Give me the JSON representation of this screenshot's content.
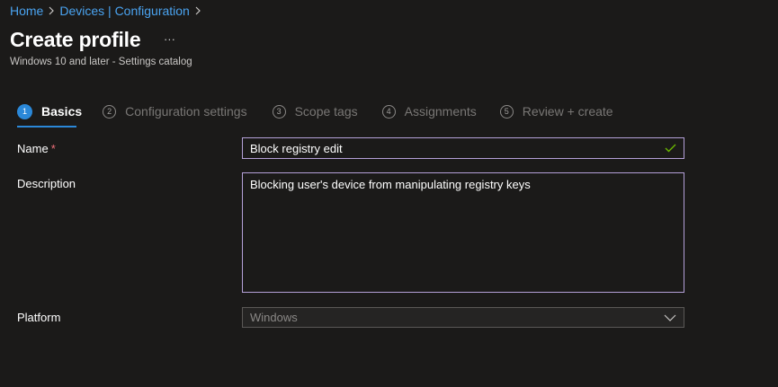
{
  "breadcrumb": {
    "items": [
      {
        "label": "Home"
      },
      {
        "label": "Devices | Configuration"
      }
    ]
  },
  "header": {
    "title": "Create profile",
    "more_label": "···",
    "subtitle": "Windows 10 and later - Settings catalog"
  },
  "wizard": {
    "steps": [
      {
        "number": "1",
        "label": "Basics",
        "active": true
      },
      {
        "number": "2",
        "label": "Configuration settings",
        "active": false
      },
      {
        "number": "3",
        "label": "Scope tags",
        "active": false
      },
      {
        "number": "4",
        "label": "Assignments",
        "active": false
      },
      {
        "number": "5",
        "label": "Review + create",
        "active": false
      }
    ]
  },
  "form": {
    "name": {
      "label": "Name",
      "required_marker": "*",
      "value": "Block registry edit"
    },
    "description": {
      "label": "Description",
      "value": "Blocking user's device from manipulating registry keys"
    },
    "platform": {
      "label": "Platform",
      "value": "Windows"
    }
  },
  "colors": {
    "accent": "#2b88d8",
    "link": "#4aa3f0",
    "valid_check": "#6bb700",
    "input_border": "#b4a0d8"
  }
}
